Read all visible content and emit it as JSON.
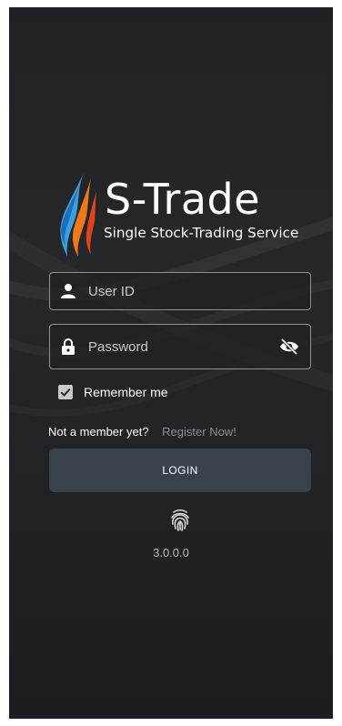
{
  "app": {
    "name": "S-Trade",
    "tagline": "Single Stock-Trading Service"
  },
  "login_form": {
    "user_id_placeholder": "User ID",
    "password_placeholder": "Password",
    "remember_label": "Remember me",
    "remember_checked": true,
    "register_question": "Not a member yet?",
    "register_link": "Register Now!",
    "login_button": "LOGIN"
  },
  "version": "3.0.0.0",
  "icons": {
    "user": "person-icon",
    "password": "lock-icon",
    "visibility": "eye-off-icon",
    "biometric": "fingerprint-icon",
    "checkbox": "check-icon"
  },
  "colors": {
    "background": "#222428",
    "button": "#3a424b",
    "logo_blue": "#3aa0e0",
    "logo_orange": "#f07a1a"
  }
}
